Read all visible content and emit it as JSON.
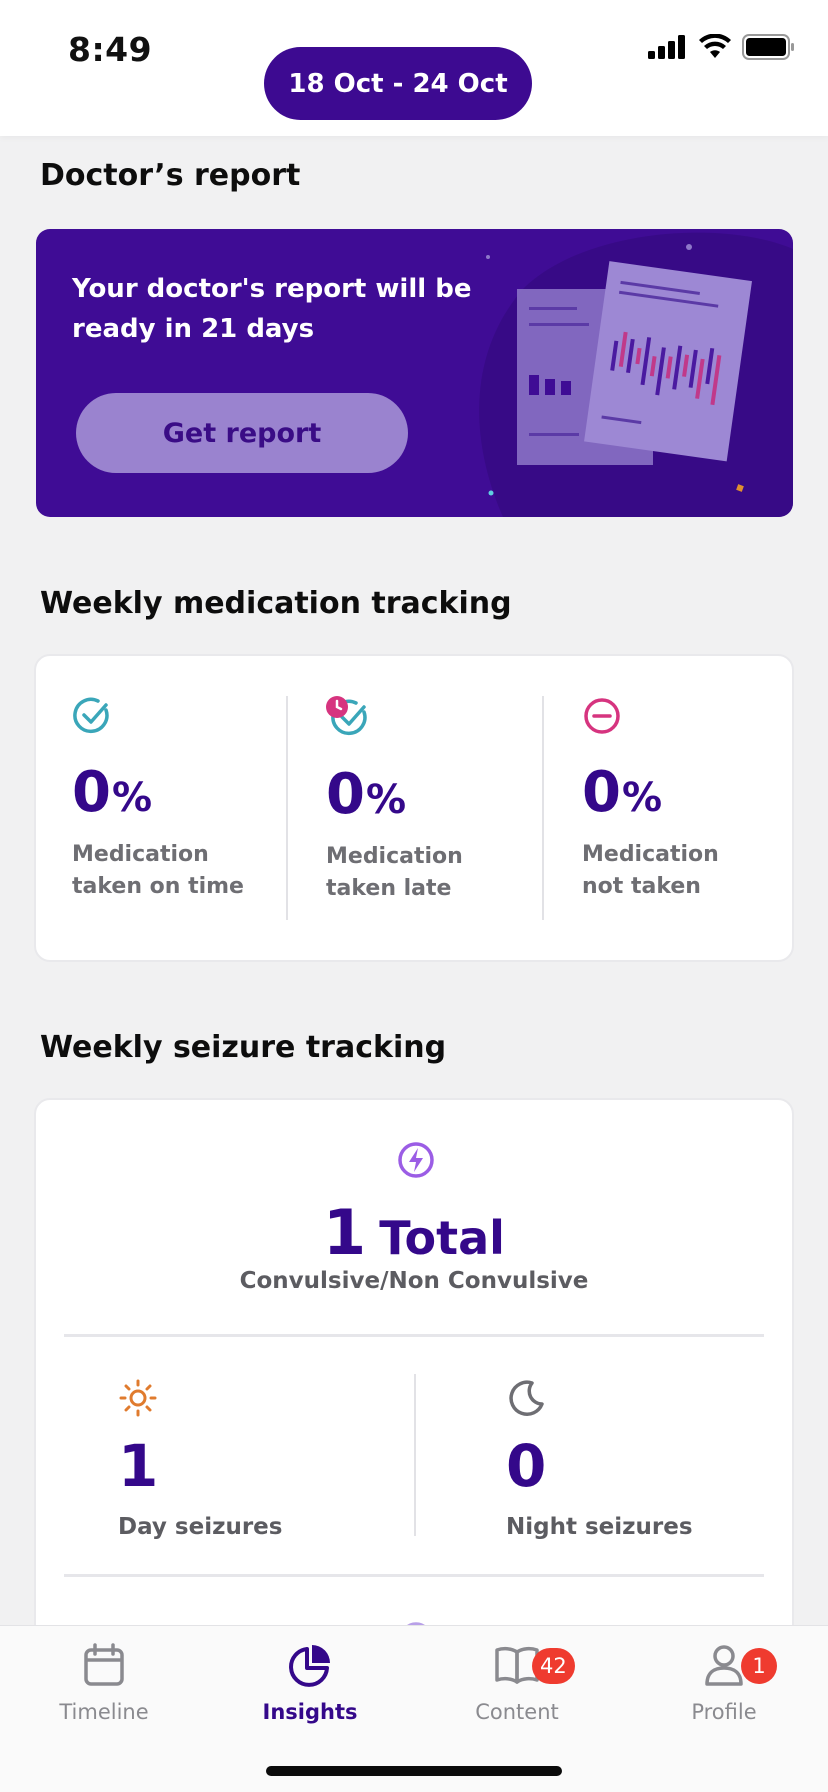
{
  "status": {
    "time": "8:49"
  },
  "header": {
    "date_range": "18 Oct - 24 Oct"
  },
  "doctor_report": {
    "section_title": "Doctor’s report",
    "message": "Your doctor's report will be ready in 21 days",
    "button_label": "Get report"
  },
  "medication": {
    "section_title": "Weekly medication tracking",
    "items": [
      {
        "value": "0",
        "unit": "%",
        "label_line1": "Medication",
        "label_line2": "taken on time",
        "icon": "check-circle-icon"
      },
      {
        "value": "0",
        "unit": "%",
        "label_line1": "Medication",
        "label_line2": "taken late",
        "icon": "check-clock-icon"
      },
      {
        "value": "0",
        "unit": "%",
        "label_line1": "Medication",
        "label_line2": "not taken",
        "icon": "minus-circle-icon"
      }
    ]
  },
  "seizure": {
    "section_title": "Weekly seizure tracking",
    "total_value": "1",
    "total_label": "Total",
    "total_sub": "Convulsive/Non Convulsive",
    "day_value": "1",
    "day_label": "Day seizures",
    "night_value": "0",
    "night_label": "Night seizures"
  },
  "tabs": [
    {
      "label": "Timeline",
      "icon": "calendar-icon"
    },
    {
      "label": "Insights",
      "icon": "pie-chart-icon",
      "active": true
    },
    {
      "label": "Content",
      "icon": "book-icon",
      "badge": "42"
    },
    {
      "label": "Profile",
      "icon": "person-icon",
      "badge": "1"
    }
  ],
  "colors": {
    "primary": "#34088a",
    "card_purple": "#3f0c95",
    "teal": "#3aa6b9",
    "magenta": "#d6347f",
    "orange": "#e07b2e",
    "badge_red": "#ef3b2f"
  }
}
